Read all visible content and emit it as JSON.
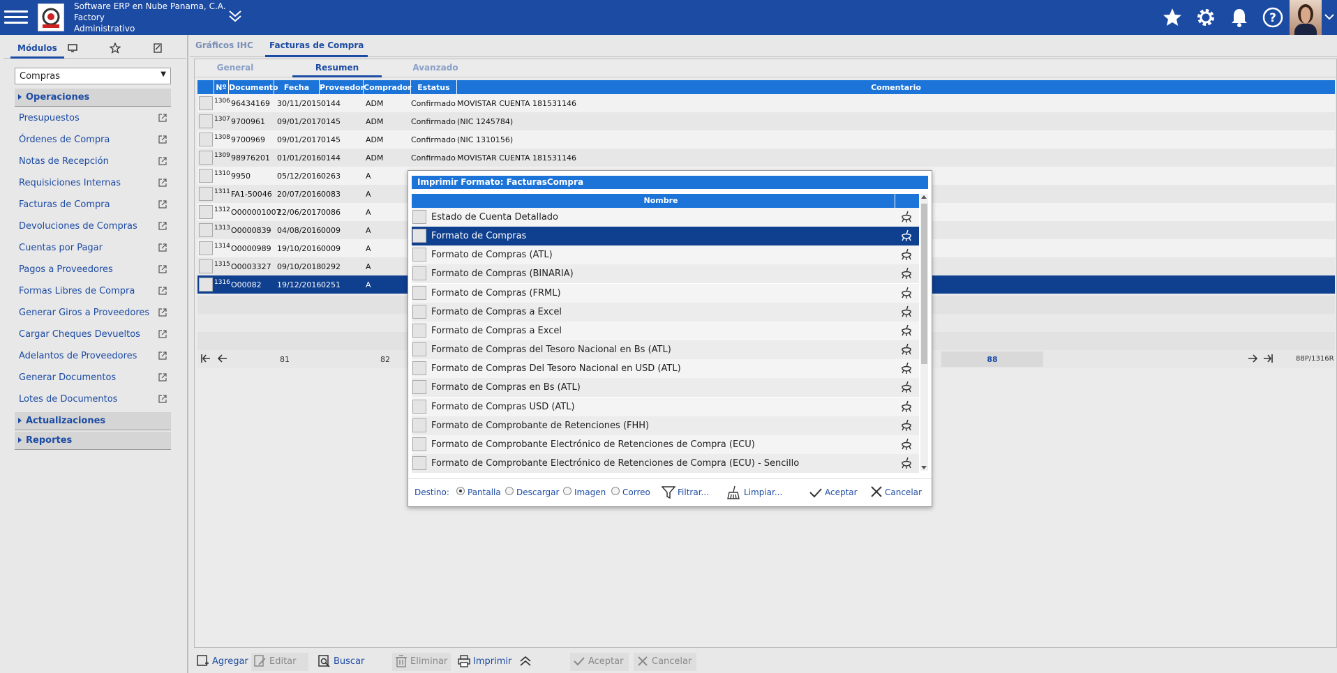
{
  "header": {
    "company": "Software ERP en Nube Panama, C.A.",
    "app": "Factory",
    "role": "Administrativo"
  },
  "left_panel": {
    "tab_modulos": "Módulos",
    "module_selected": "Compras",
    "sections": {
      "operaciones": "Operaciones",
      "actualizaciones": "Actualizaciones",
      "reportes": "Reportes"
    },
    "items": [
      "Presupuestos",
      "Órdenes de Compra",
      "Notas de Recepción",
      "Requisiciones Internas",
      "Facturas de Compra",
      "Devoluciones de Compras",
      "Cuentas por Pagar",
      "Pagos a Proveedores",
      "Formas Libres de Compra",
      "Generar Giros a Proveedores",
      "Cargar Cheques Devueltos",
      "Adelantos de Proveedores",
      "Generar Documentos",
      "Lotes de Documentos"
    ]
  },
  "main_tabs": [
    "Gráficos IHC",
    "Facturas de Compra"
  ],
  "sub_tabs": [
    "General",
    "Resumen",
    "Avanzado"
  ],
  "grid": {
    "columns": [
      "Nº",
      "Documento",
      "Fecha",
      "Proveedor",
      "Comprador",
      "Estatus",
      "Comentario"
    ],
    "rows": [
      {
        "n": "1306",
        "doc": "96434169",
        "fecha": "30/11/2015",
        "prov": "0144",
        "comp": "ADM",
        "est": "Confirmado",
        "com": "MOVISTAR CUENTA 181531146"
      },
      {
        "n": "1307",
        "doc": "9700961",
        "fecha": "09/01/2017",
        "prov": "0145",
        "comp": "ADM",
        "est": "Confirmado",
        "com": "(NIC 1245784)"
      },
      {
        "n": "1308",
        "doc": "9700969",
        "fecha": "09/01/2017",
        "prov": "0145",
        "comp": "ADM",
        "est": "Confirmado",
        "com": "(NIC 1310156)"
      },
      {
        "n": "1309",
        "doc": "98976201",
        "fecha": "01/01/2016",
        "prov": "0144",
        "comp": "ADM",
        "est": "Confirmado",
        "com": "MOVISTAR CUENTA 181531146"
      },
      {
        "n": "1310",
        "doc": "9950",
        "fecha": "05/12/2016",
        "prov": "0263",
        "comp": "A",
        "est": "",
        "com": ""
      },
      {
        "n": "1311",
        "doc": "FA1-50046",
        "fecha": "20/07/2016",
        "prov": "0083",
        "comp": "A",
        "est": "",
        "com": ""
      },
      {
        "n": "1312",
        "doc": "O000001007",
        "fecha": "22/06/2017",
        "prov": "0086",
        "comp": "A",
        "est": "",
        "com": ""
      },
      {
        "n": "1313",
        "doc": "O0000839",
        "fecha": "04/08/2016",
        "prov": "0009",
        "comp": "A",
        "est": "",
        "com": ""
      },
      {
        "n": "1314",
        "doc": "O0000989",
        "fecha": "19/10/2016",
        "prov": "0009",
        "comp": "A",
        "est": "",
        "com": ""
      },
      {
        "n": "1315",
        "doc": "O0003327",
        "fecha": "09/10/2018",
        "prov": "0292",
        "comp": "A",
        "est": "",
        "com": ""
      },
      {
        "n": "1316",
        "doc": "O00082",
        "fecha": "19/12/2016",
        "prov": "0251",
        "comp": "A",
        "est": "",
        "com": ""
      }
    ],
    "pager": {
      "p1": "81",
      "p2": "82",
      "current": "88",
      "total": "88P/1316R"
    }
  },
  "toolbar": {
    "agregar": "Agregar",
    "editar": "Editar",
    "buscar": "Buscar",
    "eliminar": "Eliminar",
    "imprimir": "Imprimir",
    "aceptar": "Aceptar",
    "cancelar": "Cancelar"
  },
  "dialog": {
    "title": "Imprimir Formato: FacturasCompra",
    "column": "Nombre",
    "selected_index": 1,
    "formats": [
      "Estado de Cuenta Detallado",
      "Formato de Compras",
      "Formato de Compras (ATL)",
      "Formato de Compras (BINARIA)",
      "Formato de Compras (FRML)",
      "Formato de Compras a Excel",
      "Formato de Compras a Excel",
      "Formato de Compras del Tesoro Nacional en Bs (ATL)",
      "Formato de Compras Del Tesoro Nacional en USD (ATL)",
      "Formato de Compras en Bs (ATL)",
      "Formato de Compras USD (ATL)",
      "Formato de Comprobante de Retenciones (FHH)",
      "Formato de Comprobante Electrónico de Retenciones de Compra (ECU)",
      "Formato de Comprobante Electrónico de Retenciones de Compra (ECU) - Sencillo"
    ],
    "footer": {
      "destino": "Destino:",
      "pantalla": "Pantalla",
      "descargar": "Descargar",
      "imagen": "Imagen",
      "correo": "Correo",
      "filtrar": "Filtrar...",
      "limpiar": "Limpiar...",
      "aceptar": "Aceptar",
      "cancelar": "Cancelar"
    }
  },
  "colors": {
    "brand": "#1c4ba3",
    "header_blue": "#1c74d9",
    "selected": "#0f3f8f"
  },
  "icons": [
    "menu-icon",
    "star-icon",
    "gear-icon",
    "bell-icon",
    "help-icon",
    "broom-icon",
    "external-link-icon"
  ]
}
